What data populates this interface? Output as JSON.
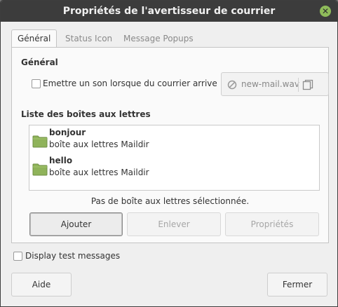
{
  "window": {
    "title": "Propriétés de l'avertisseur de courrier"
  },
  "tabs": [
    {
      "label": "Général"
    },
    {
      "label": "Status Icon"
    },
    {
      "label": "Message Popups"
    }
  ],
  "general": {
    "section_title": "Général",
    "sound_checkbox_label": "Emettre un son lorsque du courrier arrive :",
    "sound_checked": false,
    "sound_file": "new-mail.wav"
  },
  "mailboxes": {
    "section_title": "Liste des boîtes aux lettres",
    "items": [
      {
        "name": "bonjour",
        "type": "boîte aux lettres Maildir"
      },
      {
        "name": "hello",
        "type": "boîte aux lettres Maildir"
      }
    ],
    "status": "Pas de boîte aux lettres sélectionnée.",
    "add_label": "Ajouter",
    "remove_label": "Enlever",
    "properties_label": "Propriétés"
  },
  "display_test": {
    "label": "Display test messages",
    "checked": false
  },
  "footer": {
    "help_label": "Aide",
    "close_label": "Fermer"
  },
  "colors": {
    "titlebar": "#3c3c3c",
    "accent": "#8fbc5a",
    "folder": "#8fb35a"
  }
}
